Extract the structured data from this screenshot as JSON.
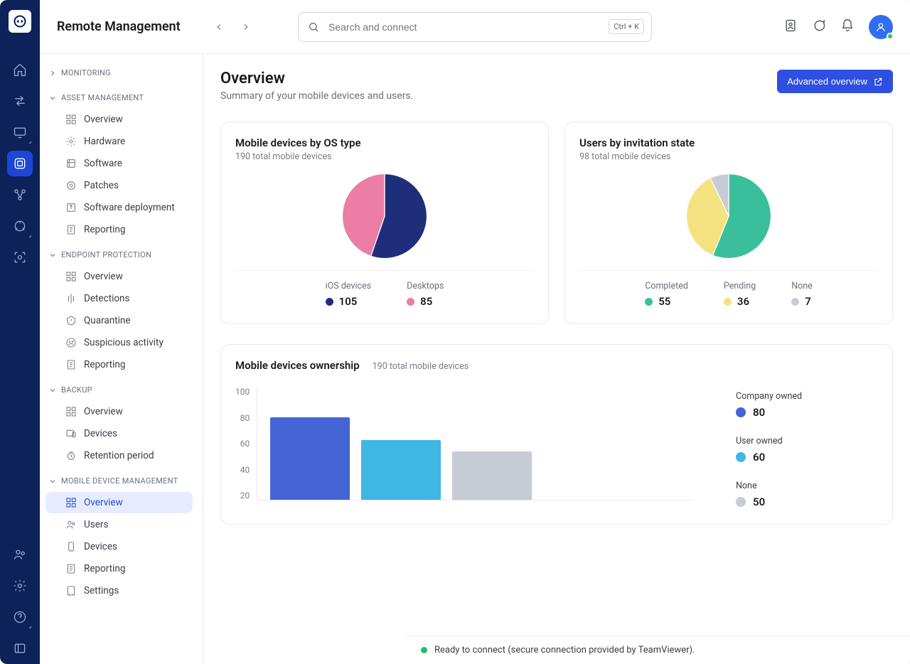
{
  "app_title": "Remote Management",
  "search": {
    "placeholder": "Search and connect",
    "kbd": "Ctrl + K"
  },
  "sidebar": {
    "groups": [
      {
        "name": "MONITORING",
        "expanded": false,
        "items": []
      },
      {
        "name": "ASSET MANAGEMENT",
        "expanded": true,
        "items": [
          {
            "label": "Overview",
            "icon": "dashboard"
          },
          {
            "label": "Hardware",
            "icon": "hardware"
          },
          {
            "label": "Software",
            "icon": "software"
          },
          {
            "label": "Patches",
            "icon": "patch"
          },
          {
            "label": "Software deployment",
            "icon": "deploy"
          },
          {
            "label": "Reporting",
            "icon": "report"
          }
        ]
      },
      {
        "name": "ENDPOINT PROTECTION",
        "expanded": true,
        "items": [
          {
            "label": "Overview",
            "icon": "dashboard"
          },
          {
            "label": "Detections",
            "icon": "detect"
          },
          {
            "label": "Quarantine",
            "icon": "quarantine"
          },
          {
            "label": "Suspicious activity",
            "icon": "suspicious"
          },
          {
            "label": "Reporting",
            "icon": "report"
          }
        ]
      },
      {
        "name": "BACKUP",
        "expanded": true,
        "items": [
          {
            "label": "Overview",
            "icon": "dashboard"
          },
          {
            "label": "Devices",
            "icon": "devices"
          },
          {
            "label": "Retention period",
            "icon": "retention"
          }
        ]
      },
      {
        "name": "MOBILE DEVICE MANAGEMENT",
        "expanded": true,
        "items": [
          {
            "label": "Overview",
            "icon": "dashboard",
            "active": true
          },
          {
            "label": "Users",
            "icon": "users"
          },
          {
            "label": "Devices",
            "icon": "phone"
          },
          {
            "label": "Reporting",
            "icon": "report"
          },
          {
            "label": "Settings",
            "icon": "settings"
          }
        ]
      }
    ]
  },
  "page": {
    "title": "Overview",
    "subtitle": "Summary of your mobile devices and users.",
    "advanced_btn": "Advanced overview"
  },
  "card_os": {
    "title": "Mobile devices by OS type",
    "subtitle": "190 total mobile devices",
    "legend": [
      {
        "label": "iOS devices",
        "value": "105"
      },
      {
        "label": "Desktops",
        "value": "85"
      }
    ]
  },
  "card_inv": {
    "title": "Users by invitation state",
    "subtitle": "98 total mobile devices",
    "legend": [
      {
        "label": "Completed",
        "value": "55"
      },
      {
        "label": "Pending",
        "value": "36"
      },
      {
        "label": "None",
        "value": "7"
      }
    ]
  },
  "card_own": {
    "title": "Mobile devices ownership",
    "subtitle": "190 total mobile devices",
    "legend": [
      {
        "label": "Company owned",
        "value": "80"
      },
      {
        "label": "User owned",
        "value": "60"
      },
      {
        "label": "None",
        "value": "50"
      }
    ],
    "yticks": [
      "100",
      "80",
      "60",
      "40",
      "20"
    ]
  },
  "status": "Ready to connect (secure connection provided by TeamViewer).",
  "colors": {
    "navy": "#1f2e7a",
    "pink": "#ec7da4",
    "teal": "#3abf9a",
    "yellow": "#f3e27f",
    "grey": "#c7cbd4",
    "blue": "#4565d6",
    "sky": "#3fb7e4"
  },
  "chart_data": [
    {
      "type": "pie",
      "title": "Mobile devices by OS type",
      "subtitle": "190 total mobile devices",
      "series": [
        {
          "name": "iOS devices",
          "value": 105,
          "color": "#1f2e7a"
        },
        {
          "name": "Desktops",
          "value": 85,
          "color": "#ec7da4"
        }
      ]
    },
    {
      "type": "pie",
      "title": "Users by invitation state",
      "subtitle": "98 total mobile devices",
      "series": [
        {
          "name": "Completed",
          "value": 55,
          "color": "#3abf9a"
        },
        {
          "name": "Pending",
          "value": 36,
          "color": "#f3e27f"
        },
        {
          "name": "None",
          "value": 7,
          "color": "#c7cbd4"
        }
      ]
    },
    {
      "type": "bar",
      "title": "Mobile devices ownership",
      "subtitle": "190 total mobile devices",
      "categories": [
        "Company owned",
        "User owned",
        "None"
      ],
      "values": [
        80,
        60,
        50
      ],
      "colors": [
        "#4565d6",
        "#3fb7e4",
        "#c7cbd4"
      ],
      "ylim": [
        0,
        100
      ],
      "yticks": [
        100,
        80,
        60,
        40,
        20
      ],
      "xlabel": "",
      "ylabel": ""
    }
  ]
}
